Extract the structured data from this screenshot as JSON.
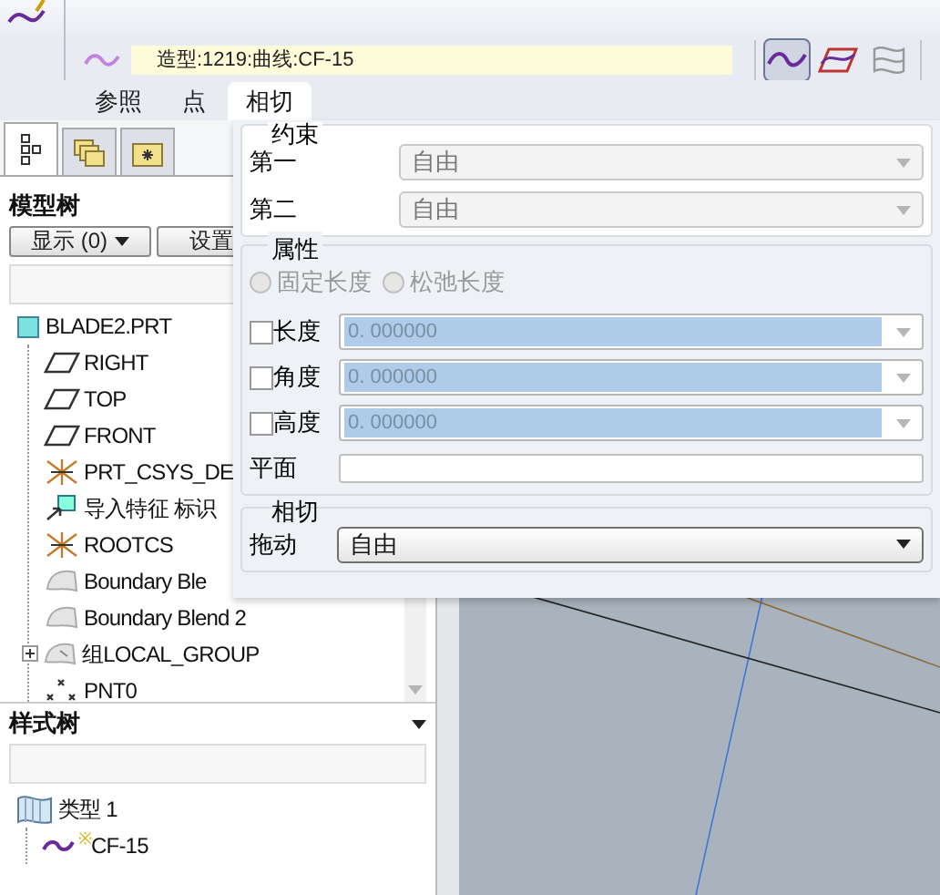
{
  "toolbar": {
    "feature_field": "造型:1219:曲线:CF-15",
    "tools": [
      {
        "kind": "curve",
        "selected": true
      },
      {
        "kind": "surface",
        "selected": false
      },
      {
        "kind": "blend",
        "selected": false
      }
    ]
  },
  "tabs": [
    {
      "label": "参照",
      "selected": false
    },
    {
      "label": "点",
      "selected": false
    },
    {
      "label": "相切",
      "selected": true
    }
  ],
  "left_panel": {
    "tabs": [
      {
        "kind": "tree",
        "selected": true
      },
      {
        "kind": "folders",
        "selected": false
      },
      {
        "kind": "favorites",
        "selected": false
      }
    ],
    "model_tree": {
      "title": "模型树",
      "buttons": [
        {
          "label": "显示 (0)",
          "dropdown": true
        },
        {
          "label": "设置",
          "dropdown": false
        }
      ],
      "items": [
        {
          "label": "BLADE2.PRT",
          "kind": "part",
          "children": [
            {
              "label": "RIGHT",
              "kind": "plane"
            },
            {
              "label": "TOP",
              "kind": "plane"
            },
            {
              "label": "FRONT",
              "kind": "plane"
            },
            {
              "label": "PRT_CSYS_DE",
              "kind": "csys"
            },
            {
              "label": "导入特征 标识",
              "kind": "import"
            },
            {
              "label": "ROOTCS",
              "kind": "csys"
            },
            {
              "label": "Boundary Ble",
              "kind": "blend"
            },
            {
              "label": "Boundary Blend 2",
              "kind": "blend"
            },
            {
              "label": "组LOCAL_GROUP",
              "kind": "group",
              "expanded": false
            },
            {
              "label": "PNT0",
              "kind": "point"
            }
          ]
        }
      ]
    },
    "style_tree": {
      "title": "样式树",
      "items": [
        {
          "label": "类型 1",
          "kind": "type",
          "children": [
            {
              "label": "CF-15",
              "kind": "curve",
              "marker": "※"
            }
          ]
        }
      ]
    }
  },
  "tangent_panel": {
    "constraints": {
      "title": "约束",
      "rows": [
        {
          "label": "第一",
          "value": "自由",
          "disabled": true
        },
        {
          "label": "第二",
          "value": "自由",
          "disabled": true
        }
      ]
    },
    "properties": {
      "title": "属性",
      "radios": [
        {
          "label": "固定长度",
          "selected": false,
          "disabled": true
        },
        {
          "label": "松弛长度",
          "selected": false,
          "disabled": true
        }
      ],
      "fields": [
        {
          "label": "长度",
          "checked": false,
          "value": "0. 000000"
        },
        {
          "label": "角度",
          "checked": false,
          "value": "0. 000000"
        },
        {
          "label": "高度",
          "checked": false,
          "value": "0. 000000"
        }
      ],
      "plane": {
        "label": "平面"
      }
    },
    "tangent": {
      "title": "相切",
      "drag": {
        "label": "拖动",
        "value": "自由",
        "disabled": false
      }
    }
  }
}
